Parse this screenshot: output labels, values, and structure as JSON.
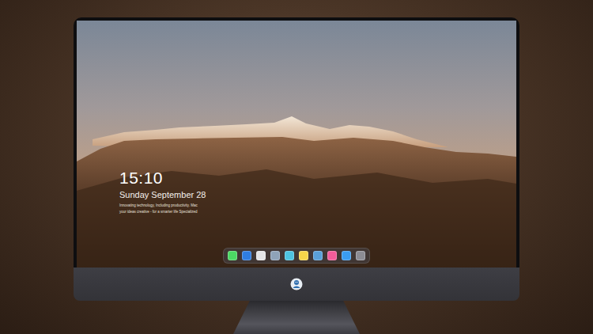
{
  "lock_screen": {
    "time": "15:10",
    "date": "Sunday September 28",
    "caption": [
      "Innovating technology, Including productivity. Mac",
      "your ideas creative - for a smarter life Specialized"
    ]
  },
  "dock": {
    "items": [
      {
        "color": "#4cd964"
      },
      {
        "color": "#2f7de1"
      },
      {
        "color": "#e4e4e6"
      },
      {
        "color": "#8fa3b8"
      },
      {
        "color": "#4ec3e0"
      },
      {
        "color": "#f5d54a"
      },
      {
        "color": "#5aa0d8"
      },
      {
        "color": "#f25c9a"
      },
      {
        "color": "#3a9cf0"
      },
      {
        "color": "#8c8c94"
      }
    ]
  }
}
